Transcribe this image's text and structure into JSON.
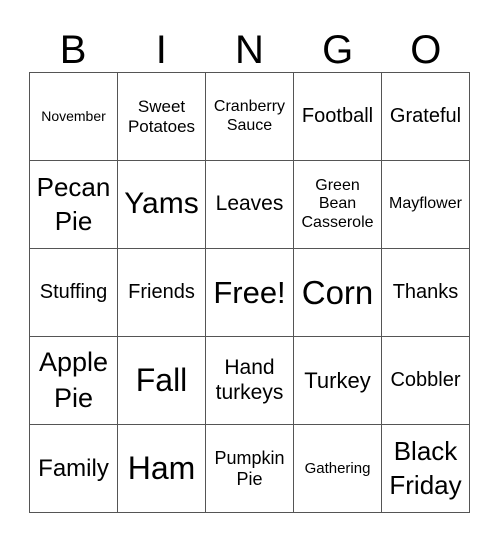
{
  "header": {
    "letters": [
      "B",
      "I",
      "N",
      "G",
      "O"
    ]
  },
  "grid": {
    "rows": [
      [
        "November",
        "Sweet Potatoes",
        "Cranberry Sauce",
        "Football",
        "Grateful"
      ],
      [
        "Pecan Pie",
        "Yams",
        "Leaves",
        "Green Bean Casserole",
        "Mayflower"
      ],
      [
        "Stuffing",
        "Friends",
        "Free!",
        "Corn",
        "Thanks"
      ],
      [
        "Apple Pie",
        "Fall",
        "Hand turkeys",
        "Turkey",
        "Cobbler"
      ],
      [
        "Family",
        "Ham",
        "Pumpkin Pie",
        "Gathering",
        "Black Friday"
      ]
    ]
  }
}
